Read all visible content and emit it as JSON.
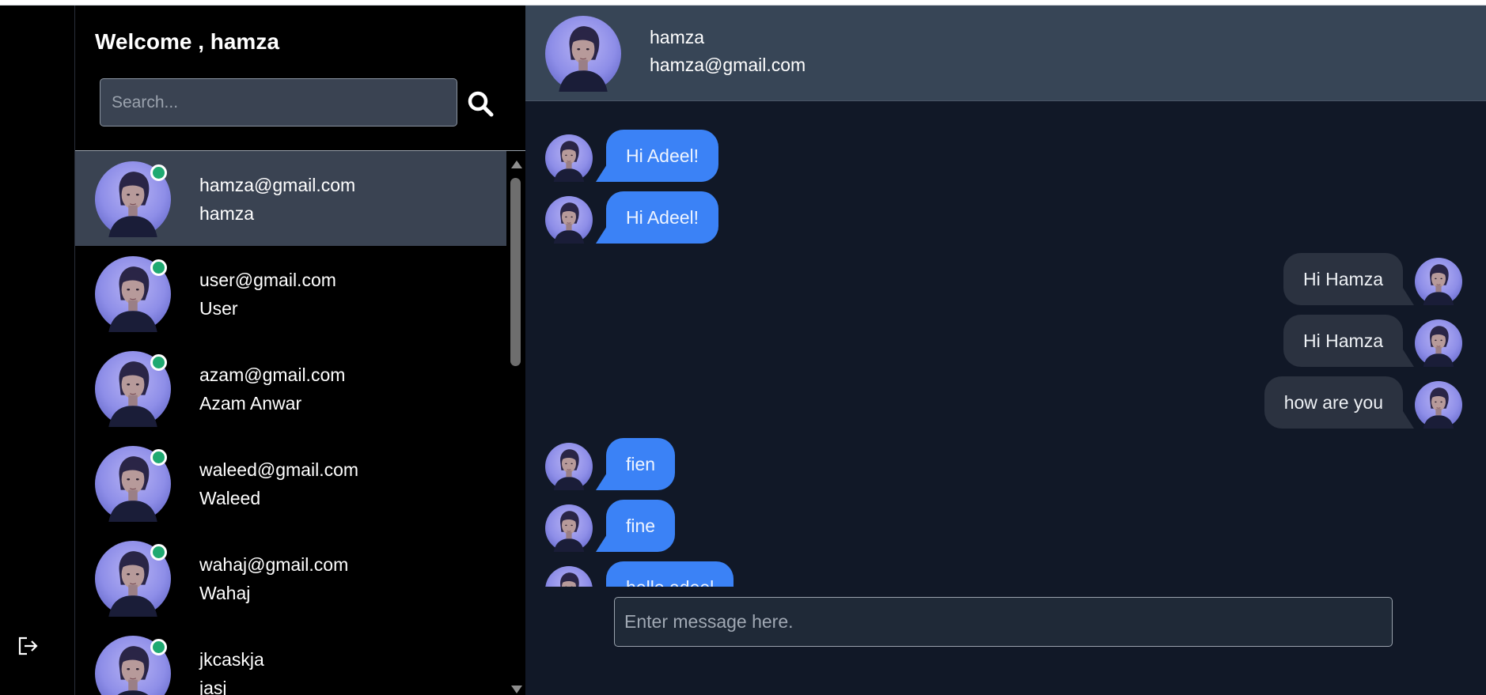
{
  "sidebar": {
    "welcome": "Welcome , hamza",
    "search_placeholder": "Search...",
    "contacts": [
      {
        "email": "hamza@gmail.com",
        "name": "hamza",
        "online": true,
        "active": true
      },
      {
        "email": "user@gmail.com",
        "name": "User",
        "online": true,
        "active": false
      },
      {
        "email": "azam@gmail.com",
        "name": "Azam Anwar",
        "online": true,
        "active": false
      },
      {
        "email": "waleed@gmail.com",
        "name": "Waleed",
        "online": true,
        "active": false
      },
      {
        "email": "wahaj@gmail.com",
        "name": "Wahaj",
        "online": true,
        "active": false
      },
      {
        "email": "jkcaskja",
        "name": "jasj",
        "online": true,
        "active": false
      }
    ]
  },
  "chat": {
    "header_name": "hamza",
    "header_email": "hamza@gmail.com",
    "messages": [
      {
        "text": "Hi Adeel!",
        "dir": "in"
      },
      {
        "text": "Hi Adeel!",
        "dir": "in"
      },
      {
        "text": "Hi Hamza",
        "dir": "out"
      },
      {
        "text": "Hi Hamza",
        "dir": "out"
      },
      {
        "text": "how are you",
        "dir": "out"
      },
      {
        "text": "fien",
        "dir": "in"
      },
      {
        "text": "fine",
        "dir": "in"
      },
      {
        "text": "hello adeel",
        "dir": "in"
      }
    ],
    "compose_placeholder": "Enter message here."
  },
  "icons": {
    "logout": "logout-icon",
    "search": "search-icon",
    "avatar": "avatar-portrait"
  },
  "colors": {
    "online": "#1fa971",
    "incoming_bubble": "#3b82f6",
    "outgoing_bubble": "#2b3240",
    "chat_bg": "#111827",
    "header_bg": "#374556",
    "active_contact": "#3a4352"
  }
}
